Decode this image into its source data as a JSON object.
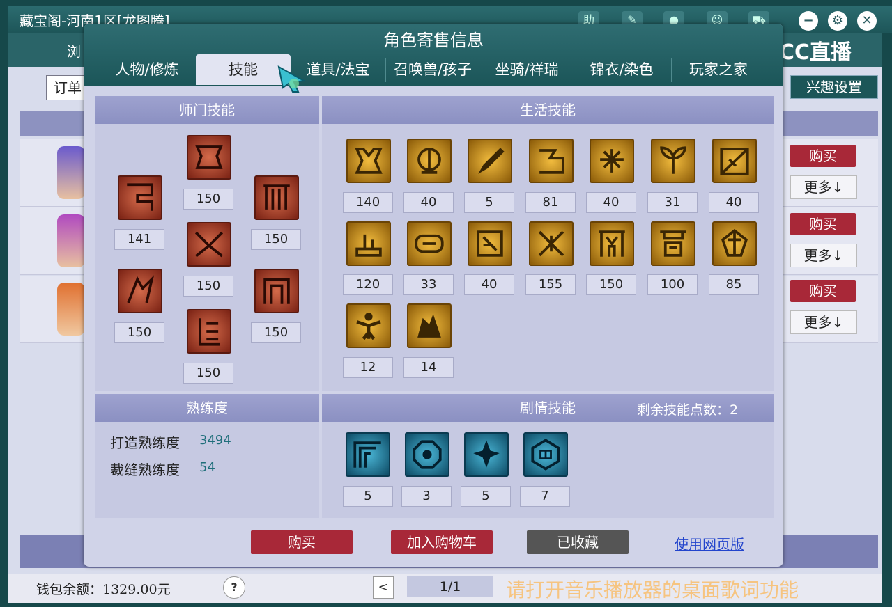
{
  "window": {
    "title": "藏宝阁-河南1区[龙图腾]",
    "tab_browse": "浏",
    "order_select": "订单",
    "interest_button": "兴趣设置",
    "watermark": "CC直播"
  },
  "background_rows": [
    {
      "buy": "购买",
      "more": "更多↓"
    },
    {
      "buy": "购买",
      "more": "更多↓"
    },
    {
      "buy": "购买",
      "more": "更多↓"
    }
  ],
  "dialog": {
    "title": "角色寄售信息",
    "tabs": [
      "人物/修炼",
      "技能",
      "道具/法宝",
      "召唤兽/孩子",
      "坐骑/祥瑞",
      "锦衣/染色",
      "玩家之家"
    ],
    "active_tab": "技能",
    "school_skills": {
      "header": "师门技能",
      "levels": [
        "150",
        "141",
        "150",
        "150",
        "150",
        "150",
        "150"
      ]
    },
    "life_skills": {
      "header": "生活技能",
      "levels": [
        "140",
        "40",
        "5",
        "81",
        "40",
        "31",
        "40",
        "120",
        "33",
        "40",
        "155",
        "150",
        "100",
        "85",
        "12",
        "14"
      ]
    },
    "proficiency": {
      "header": "熟练度",
      "items": [
        {
          "label": "打造熟练度",
          "value": "3494"
        },
        {
          "label": "裁缝熟练度",
          "value": "54"
        }
      ]
    },
    "story_skills": {
      "header": "剧情技能",
      "remaining_label": "剩余技能点数：",
      "remaining_value": "2",
      "levels": [
        "5",
        "3",
        "5",
        "7"
      ]
    },
    "buttons": {
      "buy": "购买",
      "add_to_cart": "加入购物车",
      "collected": "已收藏",
      "web_version": "使用网页版"
    }
  },
  "footer": {
    "wallet": "钱包余额：1329.00元",
    "help": "?",
    "prev": "<",
    "page": "1/1",
    "lyric": "请打开音乐播放器的桌面歌词功能"
  },
  "colors": {
    "header_teal": "#1b5558",
    "panel_header": "#8b90c2",
    "buy_red": "#a82838",
    "collected_gray": "#555555"
  }
}
